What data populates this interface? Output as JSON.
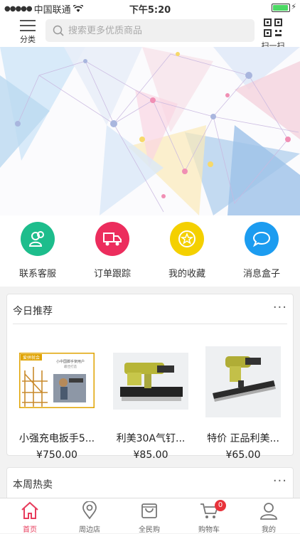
{
  "status": {
    "carrier": "中国联通",
    "time": "下午5:20"
  },
  "header": {
    "category_label": "分类",
    "search_placeholder": "搜索更多优质商品",
    "scan_label": "扫一扫"
  },
  "shortcuts": [
    {
      "label": "联系客服",
      "color": "#1dbd8c",
      "icon": "customer-service-icon"
    },
    {
      "label": "订单跟踪",
      "color": "#ec2d5d",
      "icon": "truck-icon"
    },
    {
      "label": "我的收藏",
      "color": "#f4d000",
      "icon": "star-icon"
    },
    {
      "label": "消息盒子",
      "color": "#1c9cf0",
      "icon": "chat-bubble-icon"
    }
  ],
  "recommend": {
    "title": "今日推荐",
    "more": "···",
    "products": [
      {
        "name": "小强充电扳手5...",
        "price": "¥750.00",
        "thumb_caption_top": "小中国脚手架用户",
        "thumb_caption_sub": "最佳打造",
        "thumb_badge": "爱拼就会"
      },
      {
        "name": "利美30A气钉...",
        "price": "¥85.00"
      },
      {
        "name": "特价  正品利美...",
        "price": "¥65.00"
      }
    ]
  },
  "hot": {
    "title": "本周热卖",
    "more": "···"
  },
  "tabs": [
    {
      "label": "首页",
      "icon": "home-icon",
      "active": true
    },
    {
      "label": "周边店",
      "icon": "location-pin-icon"
    },
    {
      "label": "全民购",
      "icon": "shopping-bag-icon"
    },
    {
      "label": "购物车",
      "icon": "cart-icon",
      "badge": "0"
    },
    {
      "label": "我的",
      "icon": "user-icon"
    }
  ],
  "colors": {
    "accent": "#e73c5c",
    "badge": "#e8333b"
  }
}
